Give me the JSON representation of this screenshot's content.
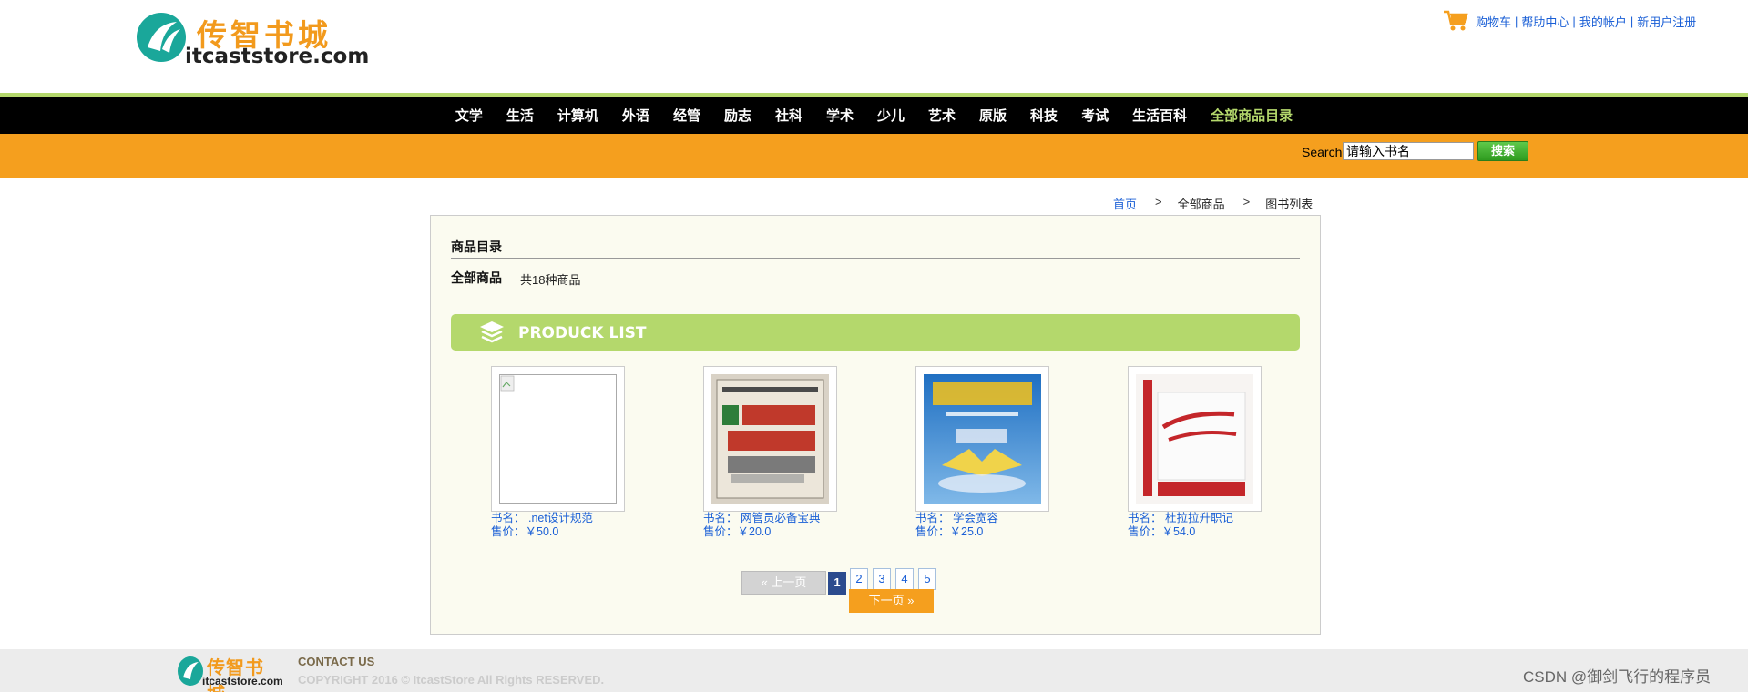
{
  "header": {
    "logo_cn": "传智书城",
    "logo_en": "itcaststore.com",
    "links": [
      "购物车",
      "帮助中心",
      "我的帐户",
      "新用户注册"
    ],
    "link_sep": "|"
  },
  "nav": {
    "items": [
      "文学",
      "生活",
      "计算机",
      "外语",
      "经管",
      "励志",
      "社科",
      "学术",
      "少儿",
      "艺术",
      "原版",
      "科技",
      "考试",
      "生活百科"
    ],
    "highlight": "全部商品目录"
  },
  "search": {
    "label": "Search",
    "value": "请输入书名",
    "button": "搜索"
  },
  "breadcrumb": {
    "home": "首页",
    "arrow": ">",
    "level2": "全部商品",
    "level3": "图书列表"
  },
  "catalog": {
    "title": "商品目录",
    "all_label": "全部商品",
    "count": "共18种商品",
    "banner": "PRODUCK LIST"
  },
  "products": [
    {
      "name_label": "书名：",
      "name": ".net设计规范",
      "price_label": "售价：",
      "price": "￥50.0",
      "cover": "broken-image"
    },
    {
      "name_label": "书名：",
      "name": "网管员必备宝典",
      "price_label": "售价：",
      "price": "￥20.0",
      "cover": "book-cover-network"
    },
    {
      "name_label": "书名：",
      "name": "学会宽容",
      "price_label": "售价：",
      "price": "￥25.0",
      "cover": "book-cover-tolerance"
    },
    {
      "name_label": "书名：",
      "name": "杜拉拉升职记",
      "price_label": "售价：",
      "price": "￥54.0",
      "cover": "book-cover-dulala"
    }
  ],
  "pagination": {
    "prev": "上一页",
    "next": "下一页",
    "pages": [
      "1",
      "2",
      "3",
      "4",
      "5"
    ],
    "current": "1"
  },
  "footer": {
    "logo_cn": "传智书城",
    "logo_en": "itcaststore.com",
    "contact": "CONTACT US",
    "copyright": "COPYRIGHT 2016 © ItcastStore All Rights RESERVED.",
    "watermark": "CSDN @御剑飞行的程序员"
  },
  "colors": {
    "accent_orange": "#f59f1e",
    "accent_green": "#b4d86c",
    "nav_bg": "#000000",
    "link_blue": "#1a5fd6"
  }
}
